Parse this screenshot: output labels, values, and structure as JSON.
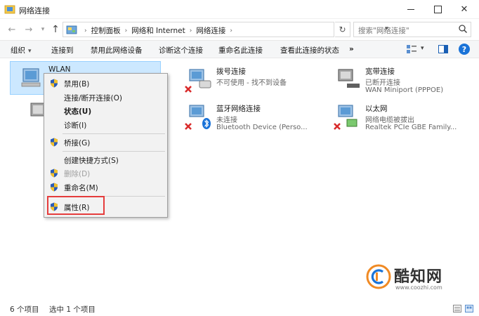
{
  "window": {
    "title": "网络连接",
    "min_glyph": "—",
    "max_glyph": "☐",
    "close_glyph": "✕"
  },
  "address": {
    "back_glyph": "←",
    "forward_glyph": "→",
    "recent_glyph": "▾",
    "up_glyph": "↑",
    "breadcrumbs": [
      "控制面板",
      "网络和 Internet",
      "网络连接"
    ],
    "separator": "›",
    "dropdown_glyph": "▾",
    "refresh_glyph": "↻",
    "search_placeholder": "搜索\"网络连接\""
  },
  "toolbar": {
    "organize": "组织",
    "connect": "连接到",
    "disable": "禁用此网络设备",
    "diagnose": "诊断这个连接",
    "rename": "重命名此连接",
    "view_status": "查看此连接的状态",
    "more": "»",
    "view_drop_glyph": "▾",
    "help_glyph": "?"
  },
  "adapters": [
    {
      "name": "WLAN",
      "status": "",
      "device": "",
      "selected": true
    },
    {
      "name": "拨号连接",
      "status": "不可使用 - 找不到设备",
      "device": "",
      "selected": false
    },
    {
      "name": "宽带连接",
      "status": "已断开连接",
      "device": "WAN Miniport (PPPOE)",
      "selected": false
    },
    {
      "name": "蓝牙网络连接",
      "status": "未连接",
      "device": "Bluetooth Device (Perso...",
      "selected": false
    },
    {
      "name": "以太网",
      "status": "网络电缆被拔出",
      "device": "Realtek PCIe GBE Family...",
      "selected": false
    }
  ],
  "context_menu": {
    "items": [
      {
        "label": "禁用(B)",
        "shield": true,
        "bold": false,
        "disabled": false
      },
      {
        "label": "连接/断开连接(O)",
        "shield": false,
        "bold": false,
        "disabled": false
      },
      {
        "label": "状态(U)",
        "shield": false,
        "bold": true,
        "disabled": false
      },
      {
        "label": "诊断(I)",
        "shield": false,
        "bold": false,
        "disabled": false
      },
      {
        "label": "桥接(G)",
        "shield": true,
        "bold": false,
        "disabled": false
      },
      {
        "label": "创建快捷方式(S)",
        "shield": false,
        "bold": false,
        "disabled": false
      },
      {
        "label": "删除(D)",
        "shield": true,
        "bold": false,
        "disabled": true
      },
      {
        "label": "重命名(M)",
        "shield": true,
        "bold": false,
        "disabled": false
      },
      {
        "label": "属性(R)",
        "shield": true,
        "bold": false,
        "disabled": false
      }
    ]
  },
  "statusbar": {
    "count": "6 个项目",
    "selected": "选中 1 个项目"
  },
  "watermark": {
    "brand": "酷知网",
    "url": "www.coozhi.com"
  },
  "colors": {
    "accent": "#1a73d8",
    "selection": "#cce8ff",
    "highlight": "#e53c3c"
  }
}
